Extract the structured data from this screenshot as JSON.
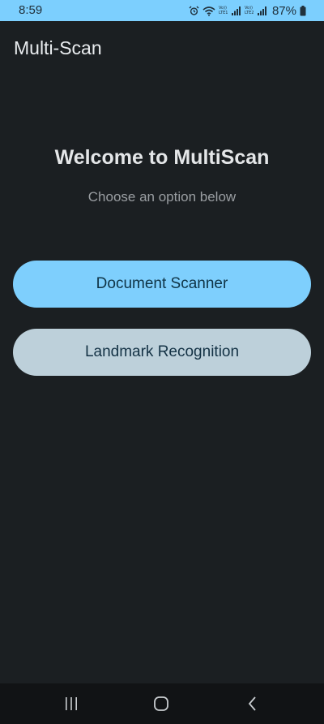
{
  "status_bar": {
    "time": "8:59",
    "battery_percent": "87%",
    "icons": [
      "alarm-icon",
      "wifi-icon",
      "volte-icon",
      "signal-icon",
      "volte-icon",
      "signal-icon",
      "battery-icon"
    ],
    "volte_label_1": "Vo))\nLTE1",
    "volte_label_2": "Vo))\nLTE2",
    "background_color": "#7ccffe"
  },
  "app_bar": {
    "title": "Multi-Scan"
  },
  "main": {
    "welcome_title": "Welcome to MultiScan",
    "subtitle": "Choose an option below",
    "buttons": [
      {
        "label": "Document Scanner",
        "color": "#7ecffd"
      },
      {
        "label": "Landmark Recognition",
        "color": "#bdd0da"
      }
    ]
  },
  "nav_bar": {
    "icons": [
      "recents-icon",
      "home-icon",
      "back-icon"
    ]
  },
  "colors": {
    "background": "#1b1f22",
    "accent": "#7ecffd"
  }
}
